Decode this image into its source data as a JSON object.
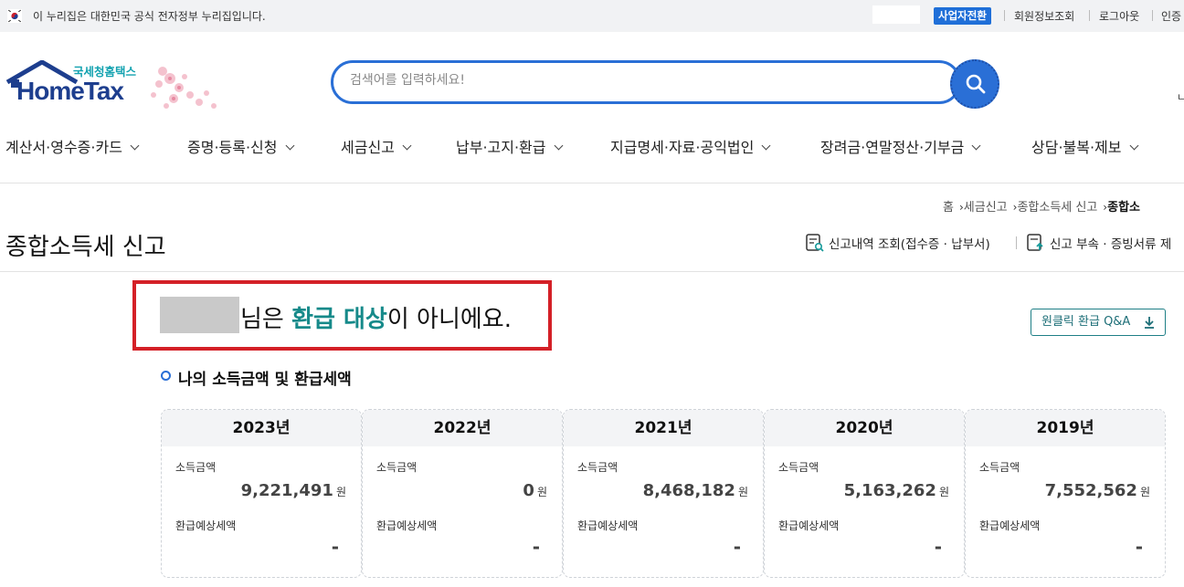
{
  "gov_banner": {
    "flag_icon": "korea-flag-icon",
    "text": "이 누리집은 대한민국 공식 전자정부 누리집입니다.",
    "business_switch": "사업자전환",
    "links": [
      "회원정보조회",
      "로그아웃",
      "인증"
    ]
  },
  "header": {
    "logo_sub": "국세청홈택스",
    "logo_main": "HomeTax",
    "search_placeholder": "검색어를 입력하세요!",
    "search_icon": "search-icon",
    "edge_letter": "ㄴ"
  },
  "nav": {
    "items": [
      "계산서·영수증·카드",
      "증명·등록·신청",
      "세금신고",
      "납부·고지·환급",
      "지급명세·자료·공익법인",
      "장려금·연말정산·기부금",
      "상담·불복·제보"
    ]
  },
  "breadcrumb": [
    "홈",
    "세금신고",
    "종합소득세 신고",
    "종합소"
  ],
  "page": {
    "title": "종합소득세 신고",
    "actions": [
      "신고내역 조회(접수증 · 납부서)",
      "신고 부속 · 증빙서류 제"
    ]
  },
  "refund": {
    "suffix_1": "님은 ",
    "highlight": "환급 대상",
    "suffix_2": "이 아니에요.",
    "qa_button": "원클릭 환급 Q&A"
  },
  "section": {
    "title": "나의 소득금액 및 환급세액"
  },
  "cards": [
    {
      "year": "2023년",
      "income_label": "소득금액",
      "income": "9,221,491",
      "unit": "원",
      "refund_label": "환급예상세액",
      "refund": "-"
    },
    {
      "year": "2022년",
      "income_label": "소득금액",
      "income": "0",
      "unit": "원",
      "refund_label": "환급예상세액",
      "refund": "-"
    },
    {
      "year": "2021년",
      "income_label": "소득금액",
      "income": "8,468,182",
      "unit": "원",
      "refund_label": "환급예상세액",
      "refund": "-"
    },
    {
      "year": "2020년",
      "income_label": "소득금액",
      "income": "5,163,262",
      "unit": "원",
      "refund_label": "환급예상세액",
      "refund": "-"
    },
    {
      "year": "2019년",
      "income_label": "소득금액",
      "income": "7,552,562",
      "unit": "원",
      "refund_label": "환급예상세액",
      "refund": "-"
    }
  ],
  "colors": {
    "accent_blue": "#2a6fd6",
    "highlight_teal": "#168a8a",
    "alert_red": "#d42027",
    "logo_navy": "#1d3e8e"
  }
}
